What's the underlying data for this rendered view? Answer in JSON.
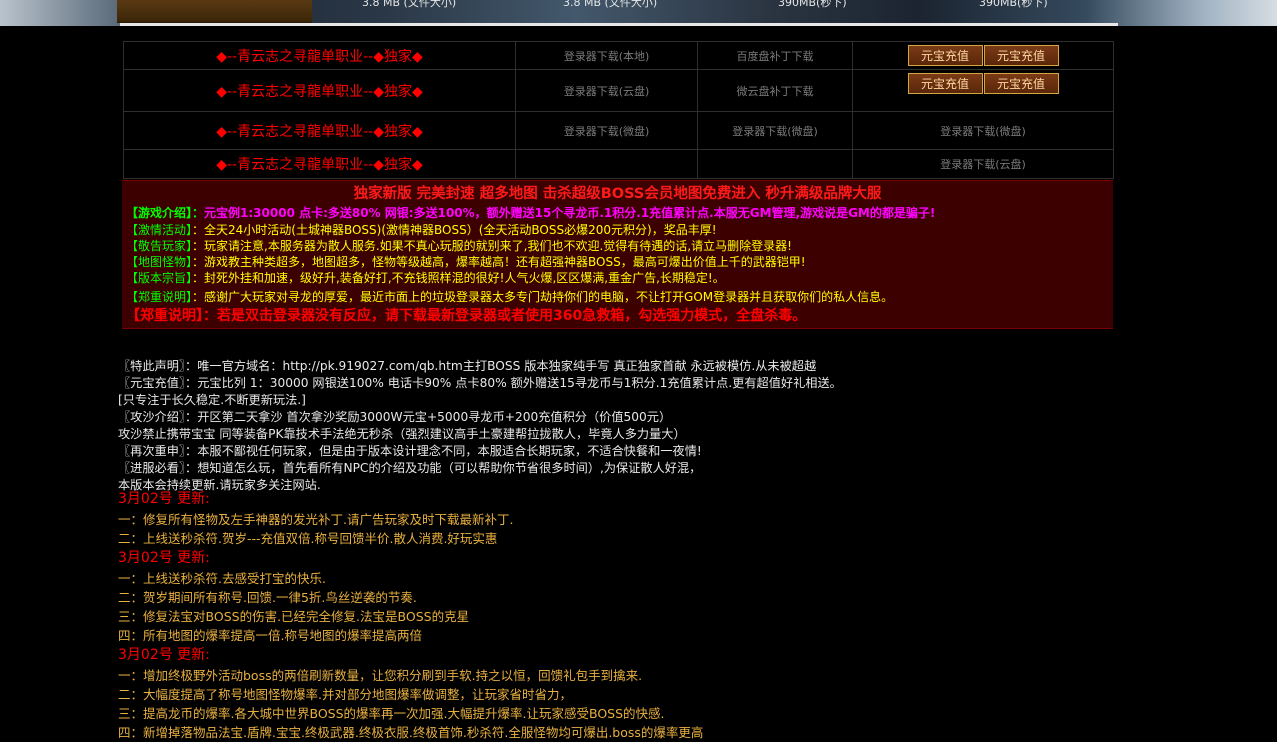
{
  "banner": {
    "dl1": "3.8 MB (文件大小)",
    "dl2": "3.8 MB (文件大小)",
    "dl3": "390MB(秒下)",
    "dl4": "390MB(秒下)"
  },
  "servers": [
    {
      "name": "◆--青云志之寻龍单职业--◆独家◆",
      "c2": "登录器下载(本地)",
      "c3": "百度盘补丁下载",
      "btn1": "元宝充值",
      "btn2": "元宝充值"
    },
    {
      "name": "◆--青云志之寻龍单职业--◆独家◆",
      "c2": "登录器下载(云盘)",
      "c3": "微云盘补丁下载",
      "btn1": "元宝充值",
      "btn2": "元宝充值"
    },
    {
      "name": "◆--青云志之寻龍单职业--◆独家◆",
      "c2": "登录器下载(微盘)",
      "c3": "登录器下载(微盘)",
      "c4": "登录器下载(微盘)"
    },
    {
      "name": "◆--青云志之寻龍单职业--◆独家◆",
      "c2": "",
      "c3": "",
      "c4": "登录器下载(云盘)"
    }
  ],
  "intro": {
    "headline": "独家新版 完美封速 超多地图 击杀超级BOSS会员地图免费进入 秒升满级品牌大服",
    "r1k": "【游戏介绍】：",
    "r1v": "元宝例1:30000 点卡:多送80% 网银:多送100%，额外赠送15个寻龙币.1积分.1充值累计点.本服无GM管理,游戏说是GM的都是骗子!",
    "r2k": "【激情活动】",
    "r2v": "：全天24小时活动(土城神器BOSS)(激情神器BOSS）(全天活动BOSS必爆200元积分)，奖品丰厚!",
    "r3k": "【敬告玩家】",
    "r3v": "：玩家请注意,本服务器为散人服务.如果不真心玩服的就别来了,我们也不欢迎.觉得有待遇的话,请立马删除登录器!",
    "r4k": "【地图怪物】",
    "r4v": "：游戏教主种类超多，地图超多，怪物等级越高，爆率越高！还有超强神器BOSS，最高可爆出价值上千的武器铠甲!",
    "r5k": "【版本宗旨】",
    "r5v": "：封死外挂和加速，级好升,装备好打,不充钱照样混的很好!人气火爆,区区爆满,重金广告,长期稳定!。",
    "r6k": "【郑重说明】",
    "r6v": "：感谢广大玩家对寻龙的厚爱，最近市面上的垃圾登录器太多专门劫持你们的电脑，不让打开GOM登录器并且获取你们的私人信息。",
    "r7": "【郑重说明】：若是双击登录器没有反应，请下载最新登录器或者使用360急救箱，勾选强力模式，全盘杀毒。"
  },
  "notice": {
    "n1": "〖特此声明〗：唯一官方域名：http://pk.919027.com/qb.htm主打BOSS 版本独家纯手写 真正独家首献 永远被模仿.从未被超越",
    "n2": "〖元宝充值〗：元宝比列 1：30000 网银送100% 电话卡90% 点卡80% 额外赠送15寻龙币与1积分.1充值累计点.更有超值好礼相送。",
    "n3": "[只专注于长久稳定.不断更新玩法.]",
    "n4": "〖攻沙介绍〗：开区第二天拿沙 首次拿沙奖励3000W元宝+5000寻龙币+200充值积分（价值500元）",
    "n5": "攻沙禁止携带宝宝 同等装备PK靠技术手法绝无秒杀（强烈建议高手土豪建帮拉拢散人，毕竟人多力量大）",
    "n6": "〖再次重申〗：本服不鄙视任何玩家，但是由于版本设计理念不同，本服适合长期玩家，不适合快餐和一夜情!",
    "n7": "〖进服必看〗：想知道怎么玩，首先看所有NPC的介绍及功能（可以帮助你节省很多时间）,为保证散人好混，",
    "n8": "本版本会持续更新.请玩家多关注网站."
  },
  "updates": [
    {
      "date": "3月02号 更新:",
      "items": [
        "一：修复所有怪物及左手神器的发光补丁.请广告玩家及时下载最新补丁.",
        "二：上线送秒杀符.贺岁---充值双倍.称号回馈半价.散人消费.好玩实惠"
      ]
    },
    {
      "date": "3月02号 更新:",
      "items": [
        "一：上线送秒杀符.去感受打宝的快乐.",
        "二：贺岁期间所有称号.回馈.一律5折.鸟丝逆袭的节奏.",
        "三：修复法宝对BOSS的伤害.已经完全修复.法宝是BOSS的克星",
        "四：所有地图的爆率提高一倍.称号地图的爆率提高两倍"
      ]
    },
    {
      "date": "3月02号 更新:",
      "items": [
        "一：增加终极野外活动boss的两倍刷新数量，让您积分刷到手软.持之以恒，回馈礼包手到擒来.",
        "二：大幅度提高了称号地图怪物爆率.并对部分地图爆率做调整，让玩家省时省力，",
        "三：提高龙币的爆率.各大城中世界BOSS的爆率再一次加强.大幅提升爆率.让玩家感受BOSS的快感.",
        "四：新增掉落物品法宝.盾牌.宝宝.终极武器.终极衣服.终极首饰.秒杀符.全服怪物均可爆出.boss的爆率更高"
      ]
    }
  ]
}
